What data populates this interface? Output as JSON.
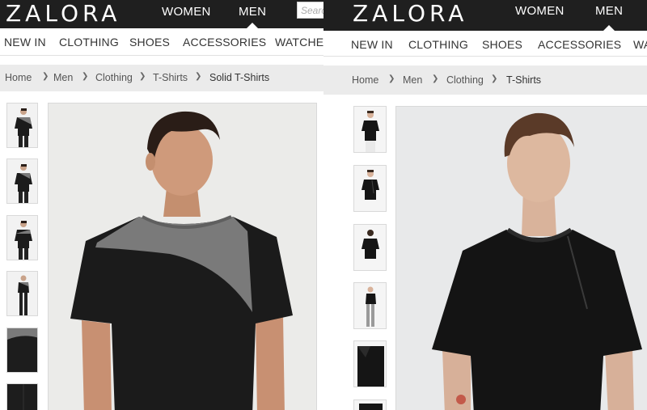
{
  "left": {
    "logo": "ZALORA",
    "nav": {
      "women": "WOMEN",
      "men": "MEN"
    },
    "search_placeholder": "Search",
    "categories": [
      "NEW IN",
      "CLOTHING",
      "SHOES",
      "ACCESSORIES",
      "WATCHES"
    ],
    "breadcrumb": [
      "Home",
      "Men",
      "Clothing",
      "T-Shirts",
      "Solid T-Shirts"
    ]
  },
  "right": {
    "logo": "ZALORA",
    "nav": {
      "women": "WOMEN",
      "men": "MEN"
    },
    "categories": [
      "NEW IN",
      "CLOTHING",
      "SHOES",
      "ACCESSORIES",
      "WA"
    ],
    "breadcrumb": [
      "Home",
      "Men",
      "Clothing",
      "T-Shirts"
    ]
  },
  "colors": {
    "header_bg": "#1f1f1f",
    "breadcrumb_bg": "#ebebeb",
    "tee_black": "#1b1b1b",
    "tee_grey": "#7a7a7a"
  },
  "icons": {
    "crumb_separator": "chevron-right-icon",
    "active_indicator": "caret-up-icon"
  }
}
